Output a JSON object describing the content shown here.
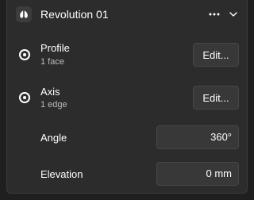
{
  "header": {
    "title": "Revolution 01",
    "icon": "revolve-feature-icon",
    "more_icon": "more-horizontal-icon",
    "collapse_icon": "chevron-down-icon"
  },
  "profile": {
    "label": "Profile",
    "sub": "1 face",
    "button": "Edit..."
  },
  "axis": {
    "label": "Axis",
    "sub": "1 edge",
    "button": "Edit..."
  },
  "angle": {
    "label": "Angle",
    "value": "360°"
  },
  "elevation": {
    "label": "Elevation",
    "value": "0 mm"
  },
  "colors": {
    "panel_bg": "#2c2c2c",
    "control_bg": "#383838",
    "text": "#ffffff",
    "subtext": "#bdbdbd"
  }
}
